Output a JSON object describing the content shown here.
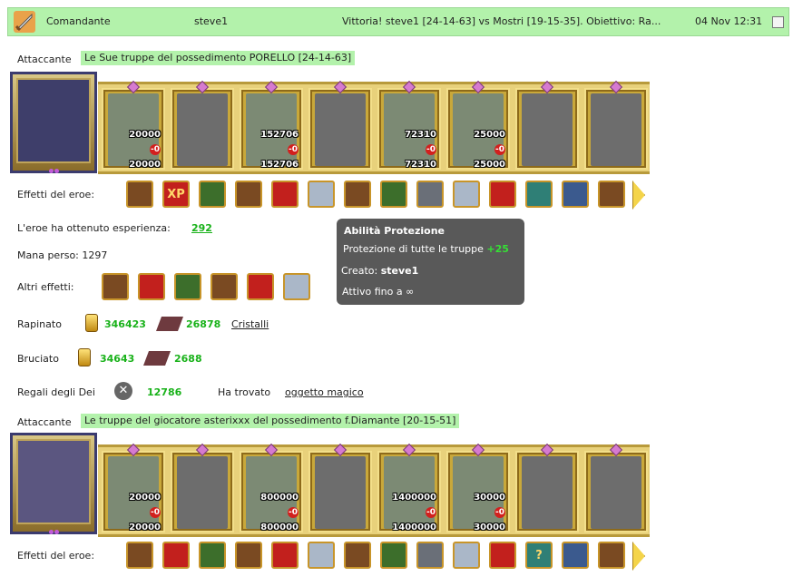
{
  "header": {
    "commander_label": "Comandante",
    "user": "steve1",
    "subject": "Vittoria! steve1 [24-14-63] vs Mostri [19-15-35]. Obiettivo: Ra...",
    "date": "04 Nov 12:31"
  },
  "block1": {
    "attacker_label": "Attaccante",
    "attacker_tag": "Le Sue truppe del possedimento PORELLO [24-14-63]",
    "troops": [
      {
        "top": "20000",
        "loss": "-0",
        "bottom": "20000",
        "color": true
      },
      {
        "top": "",
        "loss": "",
        "bottom": "",
        "color": false
      },
      {
        "top": "152706",
        "loss": "-0",
        "bottom": "152706",
        "color": true
      },
      {
        "top": "",
        "loss": "",
        "bottom": "",
        "color": false
      },
      {
        "top": "72310",
        "loss": "-0",
        "bottom": "72310",
        "color": true
      },
      {
        "top": "25000",
        "loss": "-0",
        "bottom": "25000",
        "color": true
      },
      {
        "top": "",
        "loss": "",
        "bottom": "",
        "color": false
      },
      {
        "top": "",
        "loss": "",
        "bottom": "",
        "color": false
      }
    ],
    "hero_effects_label": "Effetti del eroe:",
    "hero_effects_icons": [
      "scroll-icon",
      "xp-icon",
      "xp-potion-icon",
      "chest-icon",
      "dice-icon",
      "shield-icon",
      "shield-hand-icon",
      "whip-icon",
      "web-icon",
      "armor-icon",
      "crossed-swords-icon",
      "bow-icon",
      "cage-icon",
      "soldier-icon"
    ],
    "xp_label": "L'eroe ha ottenuto esperienza:",
    "xp_value": "292",
    "mana_label": "Mana perso: 1297",
    "other_effects_label": "Altri effetti:",
    "other_effects_icons": [
      "heart-sword-icon",
      "sword-icon",
      "heart-sword-icon",
      "sword-icon",
      "fist-icon",
      "sword-icon"
    ],
    "looted_label": "Rapinato",
    "looted_gold": "346423",
    "looted_crystal": "26878",
    "looted_link": "Cristalli",
    "burned_label": "Bruciato",
    "burned_gold": "34643",
    "burned_crystal": "2688",
    "gods_label": "Regali degli Dei",
    "gods_value": "12786",
    "found_label": "Ha trovato",
    "found_link": "oggetto magico"
  },
  "tooltip": {
    "title": "Abilità Protezione",
    "desc": "Protezione di tutte le truppe",
    "bonus": "+25",
    "created_label": "Creato:",
    "created_value": "steve1",
    "active_label": "Attivo fino a",
    "active_value": "∞"
  },
  "block2": {
    "attacker_label": "Attaccante",
    "attacker_tag": "Le truppe del giocatore asterixxx del possedimento f.Diamante [20-15-51]",
    "troops": [
      {
        "top": "20000",
        "loss": "-0",
        "bottom": "20000",
        "color": true
      },
      {
        "top": "",
        "loss": "",
        "bottom": "",
        "color": false
      },
      {
        "top": "800000",
        "loss": "-0",
        "bottom": "800000",
        "color": true
      },
      {
        "top": "",
        "loss": "",
        "bottom": "",
        "color": false
      },
      {
        "top": "1400000",
        "loss": "-0",
        "bottom": "1400000",
        "color": true
      },
      {
        "top": "30000",
        "loss": "-0",
        "bottom": "30000",
        "color": true
      },
      {
        "top": "",
        "loss": "",
        "bottom": "",
        "color": false
      },
      {
        "top": "",
        "loss": "",
        "bottom": "",
        "color": false
      }
    ],
    "hero_effects_label": "Effetti del eroe:",
    "hero_effects_icons": [
      "chest-icon",
      "dice-icon",
      "shield-icon",
      "shield-hand-icon",
      "chest-icon",
      "sword-icon",
      "handshake-icon",
      "magic-hand-icon",
      "frost-icon",
      "banner-icon",
      "flame-icon",
      "question-icon",
      "armor-icon",
      "ring-icon"
    ]
  }
}
